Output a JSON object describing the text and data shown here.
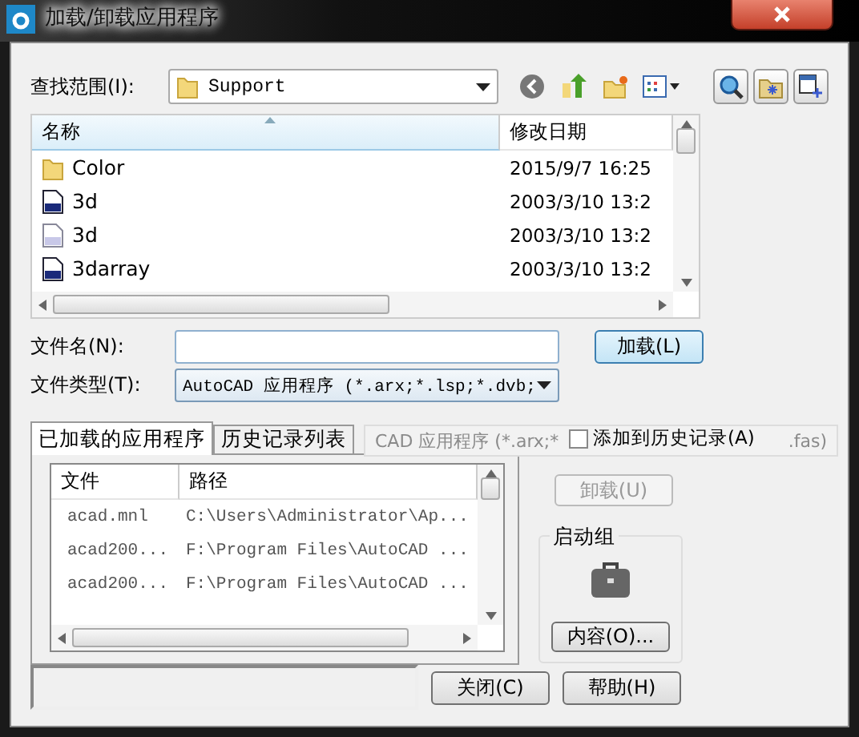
{
  "window": {
    "title": "加载/卸载应用程序"
  },
  "look_in": {
    "label": "查找范围(I):",
    "value": "Support"
  },
  "file_list": {
    "columns": [
      "名称",
      "修改日期"
    ],
    "rows": [
      {
        "kind": "folder",
        "name": "Color",
        "date": "2015/9/7 16:25"
      },
      {
        "kind": "fas",
        "name": "3d",
        "date": "2003/3/10 13:2"
      },
      {
        "kind": "lsp",
        "name": "3d",
        "date": "2003/3/10 13:2"
      },
      {
        "kind": "fas",
        "name": "3darray",
        "date": "2003/3/10 13:2"
      }
    ]
  },
  "file_name": {
    "label": "文件名(N):"
  },
  "load_button": "加载(L)",
  "file_type": {
    "label": "文件类型(T):",
    "value": "AutoCAD 应用程序 (*.arx;*.lsp;*.dvb;"
  },
  "tabs": [
    {
      "label": "已加载的应用程序",
      "selected": true
    },
    {
      "label": "历史记录列表",
      "selected": false
    }
  ],
  "ghost_tooltip": {
    "left": "CAD 应用程序 (*.arx;*",
    "right": ".fas)"
  },
  "add_to_history": {
    "label": "添加到历史记录(A)",
    "checked": false
  },
  "loaded_list": {
    "columns": [
      "文件",
      "路径"
    ],
    "rows": [
      {
        "file": "acad.mnl",
        "path": "C:\\Users\\Administrator\\Ap..."
      },
      {
        "file": "acad200...",
        "path": "F:\\Program Files\\AutoCAD ..."
      },
      {
        "file": "acad200...",
        "path": "F:\\Program Files\\AutoCAD ..."
      }
    ]
  },
  "unload_button": {
    "label": "卸载(U)",
    "disabled": true
  },
  "startup_suite": {
    "title": "启动组",
    "button": "内容(O)..."
  },
  "close_button": "关闭(C)",
  "help_button": "帮助(H)"
}
